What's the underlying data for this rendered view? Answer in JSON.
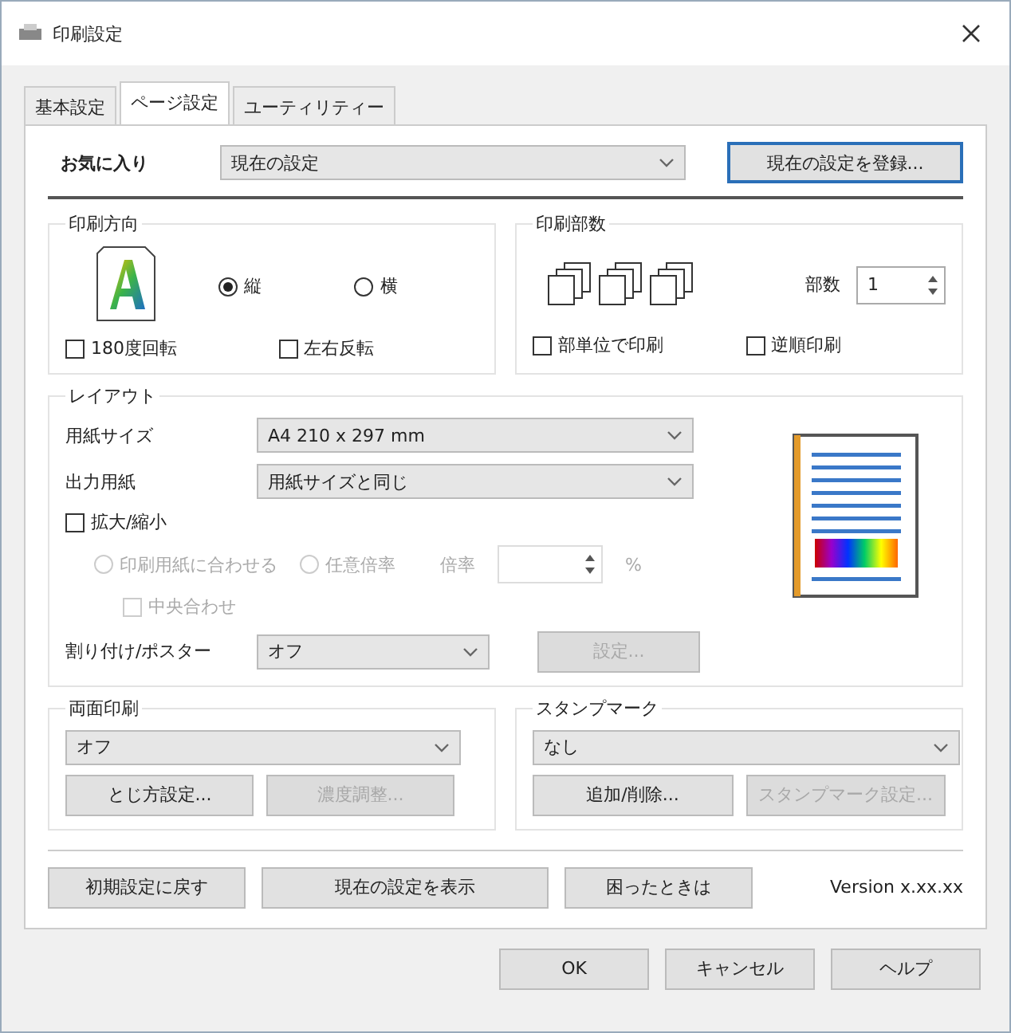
{
  "window": {
    "title": "印刷設定"
  },
  "tabs": [
    {
      "label": "基本設定",
      "selected": false
    },
    {
      "label": "ページ設定",
      "selected": true
    },
    {
      "label": "ユーティリティー",
      "selected": false
    }
  ],
  "favorites": {
    "label": "お気に入り",
    "value": "現在の設定",
    "register_button": "現在の設定を登録..."
  },
  "orientation": {
    "title": "印刷方向",
    "options": [
      {
        "label": "縦",
        "selected": true
      },
      {
        "label": "横",
        "selected": false
      }
    ],
    "checkboxes": [
      {
        "label": "180度回転",
        "checked": false
      },
      {
        "label": "左右反転",
        "checked": false
      }
    ]
  },
  "copies": {
    "title": "印刷部数",
    "label": "部数",
    "value": "1",
    "checkboxes": [
      {
        "label": "部単位で印刷",
        "checked": false
      },
      {
        "label": "逆順印刷",
        "checked": false
      }
    ]
  },
  "layout": {
    "title": "レイアウト",
    "paper_size": {
      "label": "用紙サイズ",
      "value": "A4 210 x 297 mm"
    },
    "output_paper": {
      "label": "出力用紙",
      "value": "用紙サイズと同じ"
    },
    "scale": {
      "label": "拡大/縮小",
      "checked": false
    },
    "scale_options": [
      {
        "label": "印刷用紙に合わせる",
        "selected": false,
        "disabled": true
      },
      {
        "label": "任意倍率",
        "selected": false,
        "disabled": true
      }
    ],
    "ratio": {
      "label": "倍率",
      "unit": "%",
      "disabled": true
    },
    "center": {
      "label": "中央合わせ",
      "checked": false,
      "disabled": true
    },
    "nup": {
      "label": "割り付け/ポスター",
      "value": "オフ"
    },
    "nup_button": {
      "label": "設定...",
      "disabled": true
    }
  },
  "duplex": {
    "title": "両面印刷",
    "value": "オフ",
    "buttons": [
      {
        "label": "とじ方設定...",
        "disabled": false
      },
      {
        "label": "濃度調整...",
        "disabled": true
      }
    ]
  },
  "stamp": {
    "title": "スタンプマーク",
    "value": "なし",
    "buttons": [
      {
        "label": "追加/削除...",
        "disabled": false
      },
      {
        "label": "スタンプマーク設定...",
        "disabled": true
      }
    ]
  },
  "footer_buttons": [
    "初期設定に戻す",
    "現在の設定を表示",
    "困ったときは"
  ],
  "version": "Version x.xx.xx",
  "dialog_buttons": [
    "OK",
    "キャンセル",
    "ヘルプ"
  ]
}
